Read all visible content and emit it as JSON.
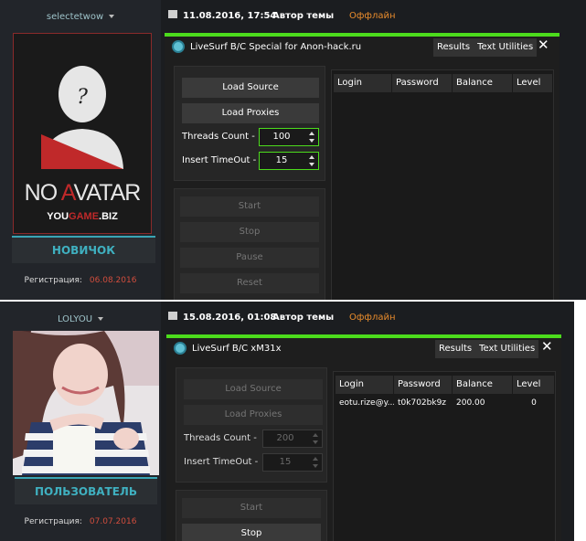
{
  "posts": [
    {
      "username": "selectetwow",
      "avatar_text": {
        "no": "NO ",
        "a": "A",
        "vatar": "VATAR",
        "you": "YOU",
        "game": "GAME",
        "biz": ".BIZ"
      },
      "rank": "НОВИЧОК",
      "reg_label": "Регистрация:",
      "reg_date": "06.08.2016",
      "datetime": "11.08.2016, 17:54",
      "author": "Автор темы",
      "status": "Оффлайн",
      "app": {
        "title": "LiveSurf B/C Special for Anon-hack.ru",
        "tabs": [
          "Results",
          "Text Utilities"
        ],
        "close": "✕",
        "buttons": {
          "load_source": "Load Source",
          "load_proxies": "Load Proxies",
          "start": "Start",
          "stop": "Stop",
          "pause": "Pause",
          "reset": "Reset"
        },
        "threads_label": "Threads Count -",
        "threads_value": "100",
        "timeout_label": "Insert TimeOut -",
        "timeout_value": "15",
        "columns": [
          "Login",
          "Password",
          "Balance",
          "Level"
        ],
        "rows": []
      }
    },
    {
      "username": "LOLYOU",
      "rank": "ПОЛЬЗОВАТЕЛЬ",
      "reg_label": "Регистрация:",
      "reg_date": "07.07.2016",
      "datetime": "15.08.2016, 01:08",
      "author": "Автор темы",
      "status": "Оффлайн",
      "app": {
        "title": "LiveSurf B/C xM31x",
        "tabs": [
          "Results",
          "Text Utilities"
        ],
        "close": "✕",
        "buttons": {
          "load_source": "Load Source",
          "load_proxies": "Load Proxies",
          "start": "Start",
          "stop": "Stop"
        },
        "threads_label": "Threads Count -",
        "threads_value": "200",
        "timeout_label": "Insert TimeOut -",
        "timeout_value": "15",
        "columns": [
          "Login",
          "Password",
          "Balance",
          "Level"
        ],
        "rows": [
          {
            "login": "eotu.rize@y...",
            "password": "t0k702bk9z",
            "balance": "200.00",
            "level": "0"
          }
        ]
      }
    }
  ],
  "colors": {
    "accent": "#4cdc1c",
    "rank": "#3fb0c0",
    "offline": "#e98c2c",
    "date": "#d14d3d"
  }
}
